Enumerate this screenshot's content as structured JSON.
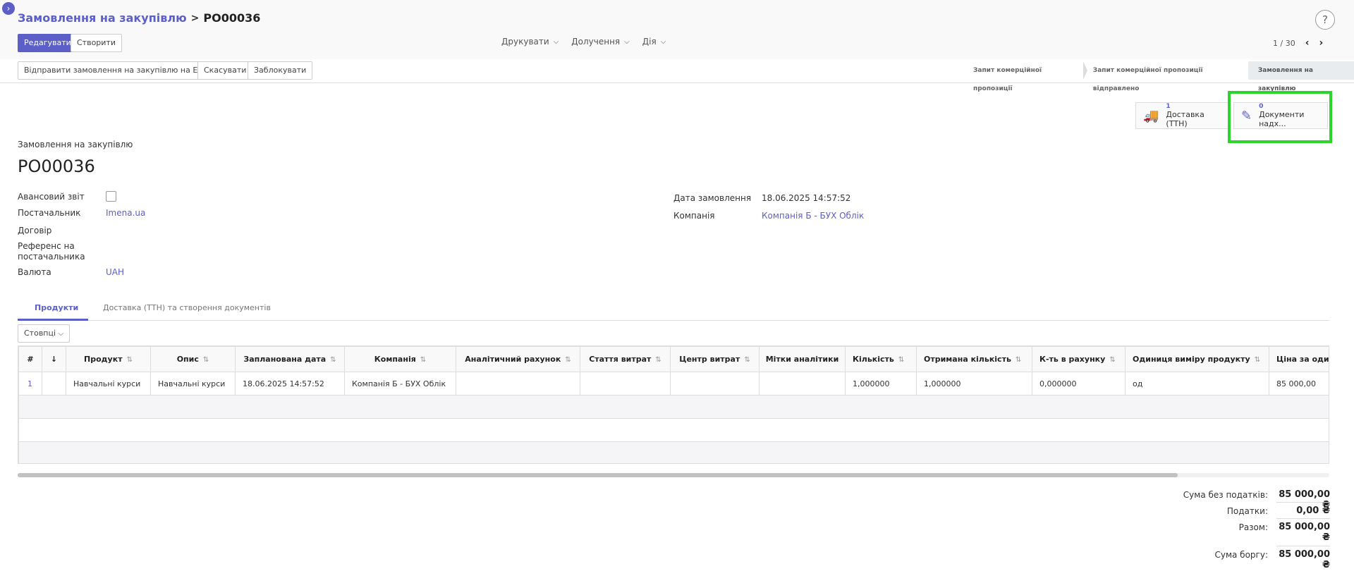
{
  "header": {
    "breadcrumb_parent": "Замовлення на закупівлю",
    "breadcrumb_separator": ">",
    "breadcrumb_current": "PO00036",
    "help": "?"
  },
  "toolbar": {
    "edit": "Редагувати",
    "create": "Створити",
    "print": "Друкувати",
    "attach": "Долучення",
    "action": "Дія",
    "pager": "1 / 30",
    "prev": "‹",
    "next": "›"
  },
  "actions": {
    "send_email": "Відправити замовлення на закупівлю на Email",
    "cancel": "Скасувати",
    "lock": "Заблокувати"
  },
  "status_steps": [
    {
      "label": "Запит комерційної пропозиції"
    },
    {
      "label": "Запит комерційної пропозиції відправлено"
    },
    {
      "label": "Замовлення на закупівлю"
    }
  ],
  "smart_buttons": {
    "delivery": {
      "count": "1",
      "label": "Доставка (ТТН)"
    },
    "documents": {
      "count": "0",
      "label": "Документи надх..."
    }
  },
  "form": {
    "record_type": "Замовлення на закупівлю",
    "name": "PO00036",
    "advance_label": "Авансовий звіт",
    "supplier_label": "Постачальник",
    "supplier": "Imena.ua",
    "contract_label": "Договір",
    "reference_label": "Референс на постачальника",
    "currency_label": "Валюта",
    "currency": "UAH",
    "order_date_label": "Дата замовлення",
    "order_date": "18.06.2025 14:57:52",
    "company_label": "Компанія",
    "company": "Компанія Б - БУХ Облік"
  },
  "tabs": {
    "products": "Продукти",
    "delivery": "Доставка (ТТН) та створення документів"
  },
  "table": {
    "columns_button": "Стовпці",
    "headers": {
      "num": "#",
      "product": "Продукт",
      "description": "Опис",
      "planned_date": "Запланована дата",
      "company": "Компанія",
      "analytic_account": "Аналітичний рахунок",
      "expense_item": "Стаття витрат",
      "cost_center": "Центр витрат",
      "analytic_tags": "Мітки аналітики",
      "quantity": "Кількість",
      "received_qty": "Отримана кількість",
      "invoiced_qty": "К-ть в рахунку",
      "uom": "Одиниця виміру продукту",
      "unit_price": "Ціна за один"
    },
    "rows": [
      {
        "num": "1",
        "product": "Навчальні курси",
        "description": "Навчальні курси",
        "planned_date": "18.06.2025 14:57:52",
        "company": "Компанія Б - БУХ Облік",
        "analytic_account": "",
        "expense_item": "",
        "cost_center": "",
        "analytic_tags": "",
        "quantity": "1,000000",
        "received_qty": "1,000000",
        "invoiced_qty": "0,000000",
        "uom": "од",
        "unit_price": "85 000,00"
      }
    ]
  },
  "totals": {
    "untaxed_label": "Сума без податків:",
    "untaxed": "85 000,00 ₴",
    "taxes_label": "Податки:",
    "taxes": "0,00 ₴",
    "total_label": "Разом:",
    "total": "85 000,00 ₴",
    "debt_label": "Сума боргу:",
    "debt": "85 000,00 ₴"
  },
  "colors": {
    "accent": "#5b5fc7",
    "highlight": "#2bd62b"
  }
}
